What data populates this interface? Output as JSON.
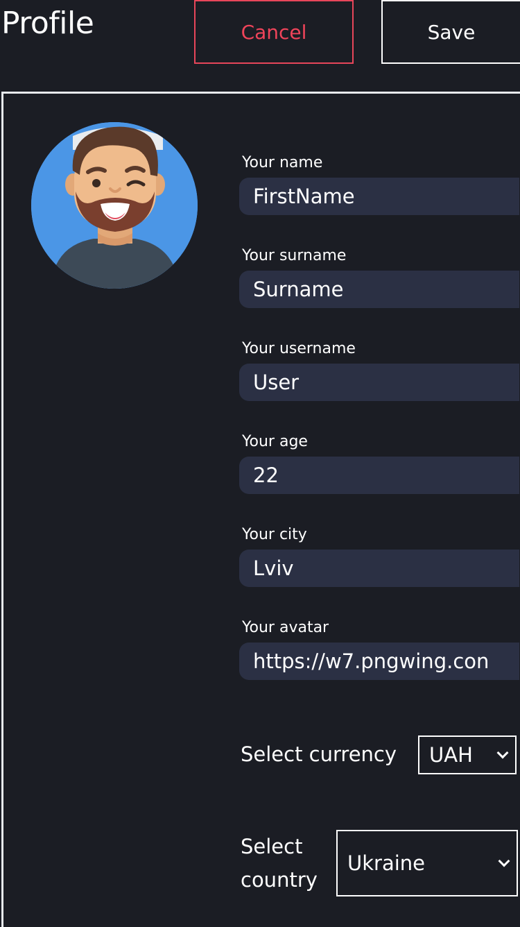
{
  "header": {
    "title": "Profile",
    "cancel_label": "Cancel",
    "save_label": "Save"
  },
  "colors": {
    "background": "#1b1d24",
    "input_bg": "#2b3044",
    "cancel_accent": "#f0445a",
    "avatar_bg": "#4b96e6"
  },
  "avatar": {
    "icon": "user-avatar-cartoon"
  },
  "form": {
    "name_label": "Your name",
    "name_value": "FirstName",
    "surname_label": "Your surname",
    "surname_value": "Surname",
    "username_label": "Your username",
    "username_value": "User",
    "age_label": "Your age",
    "age_value": "22",
    "city_label": "Your city",
    "city_value": "Lviv",
    "avatar_label": "Your avatar",
    "avatar_value": "https://w7.pngwing.con"
  },
  "currency": {
    "label": "Select currency",
    "selected": "UAH"
  },
  "country": {
    "label_line1": "Select",
    "label_line2": "country",
    "selected": "Ukraine"
  }
}
